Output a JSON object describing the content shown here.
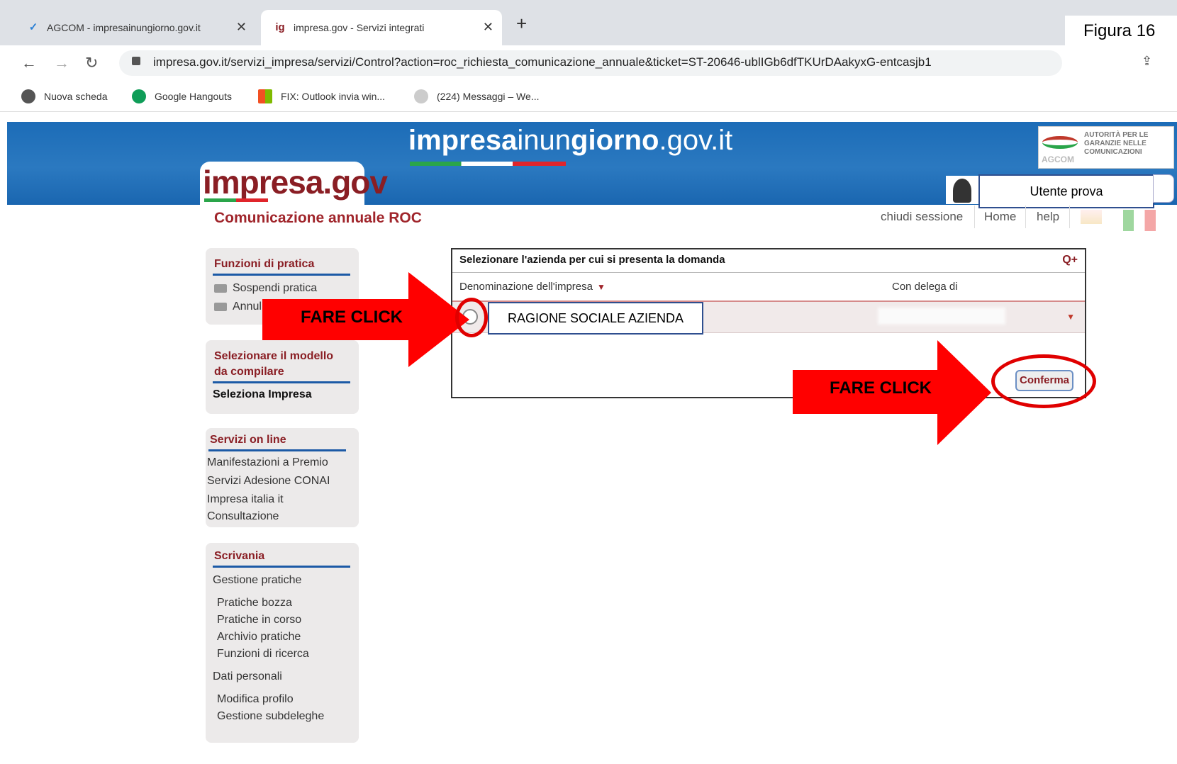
{
  "browser": {
    "tabs": [
      {
        "label": "AGCOM - impresainungiorno.gov.it",
        "icon": "agcom-favicon-icon"
      },
      {
        "label": "impresa.gov - Servizi integrati",
        "icon": "impresa-gov-favicon-icon"
      }
    ],
    "url": "impresa.gov.it/servizi_impresa/servizi/Control?action=roc_richiesta_comunicazione_annuale&ticket=ST-20646-ublIGb6dfTKUrDAakyxG-entcasjb1",
    "bookmarks": [
      {
        "label": "Nuova scheda",
        "color": "#555555"
      },
      {
        "label": "Google Hangouts",
        "color": "#0f9d58"
      },
      {
        "label": "FIX: Outlook invia win...",
        "color": "#f4b400"
      },
      {
        "label": "(224) Messaggi – We...",
        "color": "#bbbbbb"
      }
    ]
  },
  "figure_label": "Figura 16",
  "site": {
    "title_bold": "impresa",
    "title_normal": "inun",
    "title_bold2": "giorno",
    "title_tail": ".gov.it",
    "agcom_text": "AUTORITÀ PER LE GARANZIE NELLE COMUNICAZIONI",
    "agcom_short": "AGCOM",
    "logo": "impresa.gov"
  },
  "user": {
    "name": "Utente prova"
  },
  "page_heading": "Comunicazione annuale ROC",
  "top_links": [
    "chiudi sessione",
    "Home",
    "help"
  ],
  "sidebar": {
    "funzioni": {
      "title": "Funzioni di pratica",
      "items": [
        "Sospendi pratica",
        "Annulla"
      ]
    },
    "modello": {
      "title": "Selezionare il modello da compilare",
      "items": [
        "Seleziona Impresa"
      ]
    },
    "servizi": {
      "title": "Servizi on line",
      "items": [
        "Manifestazioni a Premio",
        "Servizi Adesione CONAI",
        "Impresa italia it",
        "Consultazione"
      ]
    },
    "scrivania": {
      "title": "Scrivania",
      "gestione": "Gestione pratiche",
      "gestione_items": [
        "Pratiche bozza",
        "Pratiche in corso",
        "Archivio pratiche",
        "Funzioni di ricerca"
      ],
      "dati": "Dati personali",
      "dati_items": [
        "Modifica profilo",
        "Gestione subdeleghe"
      ]
    }
  },
  "panel": {
    "title": "Selezionare l'azienda per cui si presenta la domanda",
    "col_denominazione": "Denominazione dell'impresa",
    "col_delega": "Con delega di",
    "row_azienda": "RAGIONE SOCIALE AZIENDA",
    "confirm_label": "Conferma"
  },
  "annotations": {
    "click1": "FARE CLICK",
    "click2": "FARE CLICK",
    "arrow_color": "#ff0000"
  }
}
